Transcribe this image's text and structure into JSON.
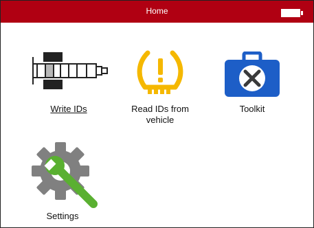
{
  "header": {
    "title": "Home",
    "battery_icon": "battery-icon",
    "color": "#b00012"
  },
  "tiles": [
    {
      "label": "Write IDs",
      "icon": "axle-icon",
      "selected": true
    },
    {
      "label": "Read IDs from vehicle",
      "icon": "tpms-warning-icon",
      "color": "#f5b800"
    },
    {
      "label": "Toolkit",
      "icon": "toolbox-icon",
      "color": "#1d5ec7"
    },
    {
      "label": "Settings",
      "icon": "gear-wrench-icon",
      "colors": [
        "#808080",
        "#5ab031"
      ]
    }
  ]
}
